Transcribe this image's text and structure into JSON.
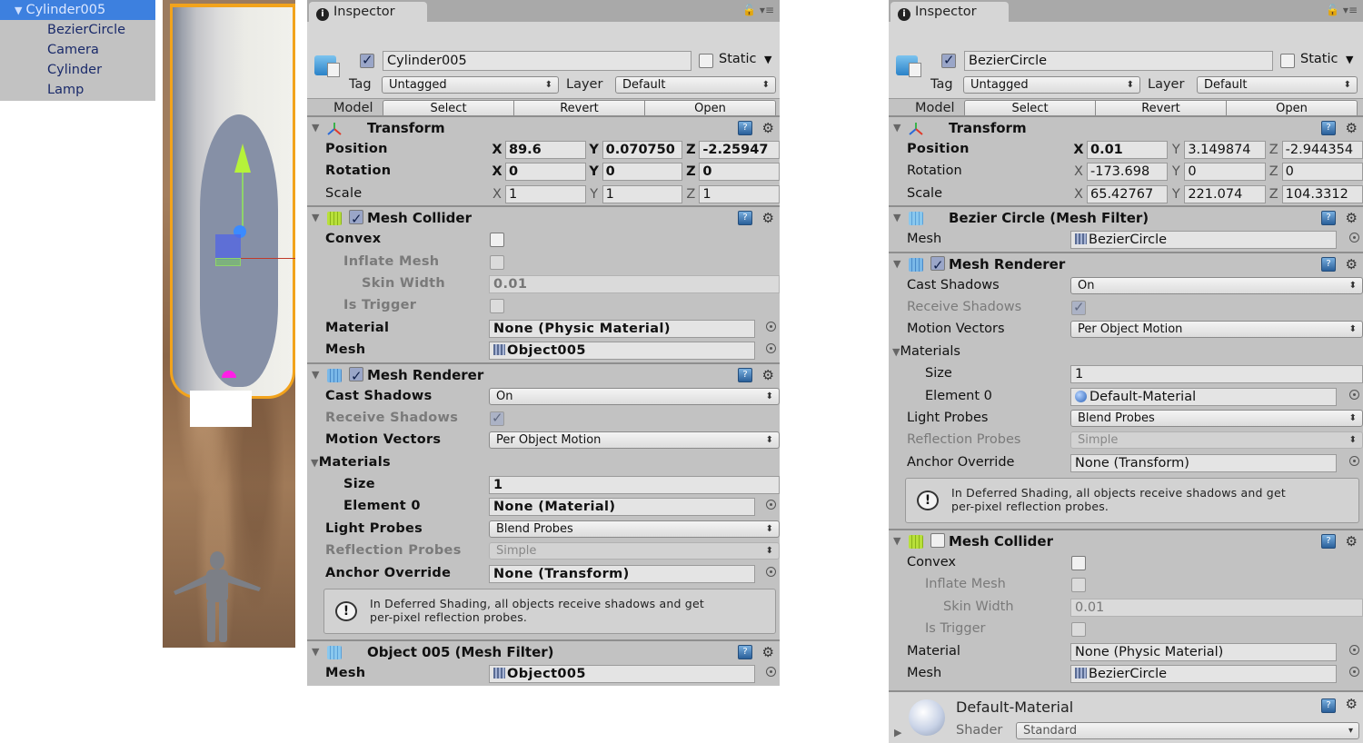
{
  "hierarchy": {
    "selected": "Cylinder005",
    "children": [
      "BezierCircle",
      "Camera",
      "Cylinder",
      "Lamp"
    ]
  },
  "colors": {
    "selection": "#3d80df",
    "panel": "#c2c2c2",
    "selection_outline": "#f2a31c"
  },
  "left_inspector": {
    "tab": "Inspector",
    "object": {
      "active": true,
      "name": "Cylinder005",
      "static_label": "Static",
      "static": false,
      "tag_label": "Tag",
      "tag": "Untagged",
      "layer_label": "Layer",
      "layer": "Default",
      "model_label": "Model",
      "buttons": [
        "Select",
        "Revert",
        "Open"
      ]
    },
    "transform": {
      "title": "Transform",
      "position": {
        "label": "Position",
        "x": "89.6",
        "y": "0.070750",
        "z": "-2.25947"
      },
      "rotation": {
        "label": "Rotation",
        "x": "0",
        "y": "0",
        "z": "0"
      },
      "scale": {
        "label": "Scale",
        "x": "1",
        "y": "1",
        "z": "1"
      }
    },
    "mesh_collider": {
      "title": "Mesh Collider",
      "enabled": true,
      "convex_label": "Convex",
      "inflate_label": "Inflate Mesh",
      "skin_label": "Skin Width",
      "skin_value": "0.01",
      "trigger_label": "Is Trigger",
      "material_label": "Material",
      "material_value": "None (Physic Material)",
      "mesh_label": "Mesh",
      "mesh_value": "Object005"
    },
    "mesh_renderer": {
      "title": "Mesh Renderer",
      "enabled": true,
      "cast_label": "Cast Shadows",
      "cast_value": "On",
      "receive_label": "Receive Shadows",
      "motion_label": "Motion Vectors",
      "motion_value": "Per Object Motion",
      "materials_label": "Materials",
      "size_label": "Size",
      "size_value": "1",
      "element_label": "Element 0",
      "element_value": "None (Material)",
      "light_label": "Light Probes",
      "light_value": "Blend Probes",
      "reflection_label": "Reflection Probes",
      "reflection_value": "Simple",
      "anchor_label": "Anchor Override",
      "anchor_value": "None (Transform)",
      "help_line1": "In Deferred Shading, all objects receive shadows and get",
      "help_line2": "per-pixel reflection probes."
    },
    "mesh_filter": {
      "title": "Object 005 (Mesh Filter)",
      "mesh_label": "Mesh",
      "mesh_value": "Object005"
    }
  },
  "right_inspector": {
    "tab": "Inspector",
    "object": {
      "active": true,
      "name": "BezierCircle",
      "static_label": "Static",
      "static": false,
      "tag_label": "Tag",
      "tag": "Untagged",
      "layer_label": "Layer",
      "layer": "Default",
      "model_label": "Model",
      "buttons": [
        "Select",
        "Revert",
        "Open"
      ]
    },
    "transform": {
      "title": "Transform",
      "position": {
        "label": "Position",
        "x": "0.01",
        "y": "3.149874",
        "z": "-2.944354"
      },
      "rotation": {
        "label": "Rotation",
        "x": "-173.698",
        "y": "0",
        "z": "0"
      },
      "scale": {
        "label": "Scale",
        "x": "65.42767",
        "y": "221.074",
        "z": "104.3312"
      }
    },
    "mesh_filter": {
      "title": "Bezier Circle (Mesh Filter)",
      "mesh_label": "Mesh",
      "mesh_value": "BezierCircle"
    },
    "mesh_renderer": {
      "title": "Mesh Renderer",
      "enabled": true,
      "cast_label": "Cast Shadows",
      "cast_value": "On",
      "receive_label": "Receive Shadows",
      "motion_label": "Motion Vectors",
      "motion_value": "Per Object Motion",
      "materials_label": "Materials",
      "size_label": "Size",
      "size_value": "1",
      "element_label": "Element 0",
      "element_value": "Default-Material",
      "light_label": "Light Probes",
      "light_value": "Blend Probes",
      "reflection_label": "Reflection Probes",
      "reflection_value": "Simple",
      "anchor_label": "Anchor Override",
      "anchor_value": "None (Transform)",
      "help_line1": "In Deferred Shading, all objects receive shadows and get",
      "help_line2": "per-pixel reflection probes."
    },
    "mesh_collider": {
      "title": "Mesh Collider",
      "enabled": false,
      "convex_label": "Convex",
      "inflate_label": "Inflate Mesh",
      "skin_label": "Skin Width",
      "skin_value": "0.01",
      "trigger_label": "Is Trigger",
      "material_label": "Material",
      "material_value": "None (Physic Material)",
      "mesh_label": "Mesh",
      "mesh_value": "BezierCircle"
    },
    "material": {
      "name": "Default-Material",
      "shader_label": "Shader",
      "shader_value": "Standard"
    }
  }
}
